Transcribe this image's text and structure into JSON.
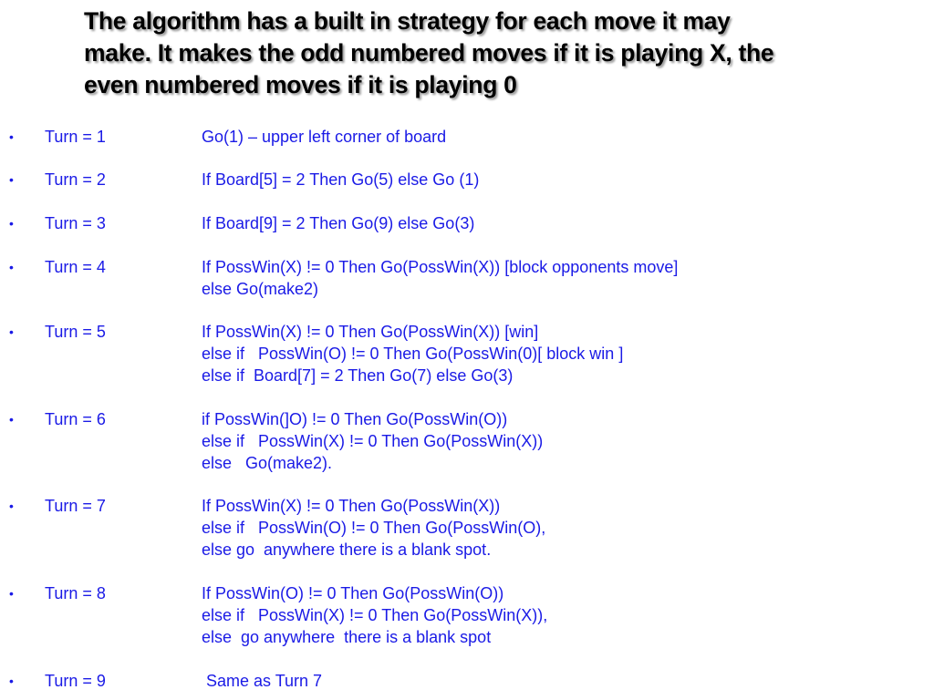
{
  "slide": {
    "title_lines": [
      "The algorithm has a built in strategy for each move it may",
      "make. It makes the odd numbered moves if it is playing X, the",
      "even numbered moves if it is playing 0"
    ],
    "colors": {
      "title": "#000000",
      "body": "#1a1ae6",
      "background": "#ffffff"
    },
    "bullet_glyph": "•",
    "rules": [
      {
        "turn": "Turn = 1",
        "lines": [
          "Go(1) – upper left corner of board"
        ]
      },
      {
        "turn": "Turn = 2",
        "lines": [
          "If Board[5] = 2 Then Go(5) else Go (1)"
        ]
      },
      {
        "turn": "Turn = 3",
        "lines": [
          "If Board[9] = 2 Then Go(9) else Go(3)"
        ]
      },
      {
        "turn": "Turn = 4",
        "lines": [
          "If PossWin(X) != 0 Then Go(PossWin(X)) [block opponents move]",
          "else Go(make2)"
        ]
      },
      {
        "turn": "Turn = 5",
        "lines": [
          "If PossWin(X) != 0 Then Go(PossWin(X)) [win]",
          "else if   PossWin(O) != 0 Then Go(PossWin(0)[ block win ]",
          "else if  Board[7] = 2 Then Go(7) else Go(3)"
        ]
      },
      {
        "turn": "Turn = 6",
        "lines": [
          "if PossWin(]O) != 0 Then Go(PossWin(O))",
          "else if   PossWin(X) != 0 Then Go(PossWin(X))",
          "else   Go(make2)."
        ]
      },
      {
        "turn": "Turn = 7",
        "lines": [
          "If PossWin(X) != 0 Then Go(PossWin(X))",
          "else if   PossWin(O) != 0 Then Go(PossWin(O),",
          "else go  anywhere there is a blank spot."
        ]
      },
      {
        "turn": "Turn = 8",
        "lines": [
          "If PossWin(O) != 0 Then Go(PossWin(O))",
          "else if   PossWin(X) != 0 Then Go(PossWin(X)),",
          "else  go anywhere  there is a blank spot"
        ]
      },
      {
        "turn": "Turn = 9",
        "lines": [
          " Same as Turn 7"
        ]
      }
    ]
  }
}
